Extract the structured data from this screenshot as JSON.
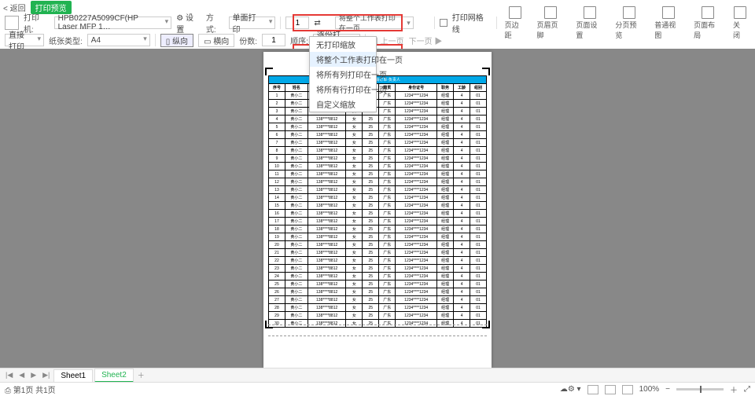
{
  "topbar": {
    "back": "< 返回",
    "title": "打印预览"
  },
  "toolbar": {
    "printer_label": "打印机:",
    "printer_name": "HPB0227A5099CF(HP Laser MFP 1…",
    "settings": "设置",
    "mode_label": "方式:",
    "mode_value": "单面打印",
    "copies_from": "1",
    "direct_print": "直接打印",
    "paper_label": "纸张类型:",
    "paper_value": "A4",
    "orient_portrait": "纵向",
    "orient_landscape": "横向",
    "copies_label": "份数:",
    "copies_value": "1",
    "order_label": "顺序:",
    "order_value": "逐份打印",
    "prev_page": "上一页",
    "next_page": "下一页",
    "scale_value": "将整个工作表打印在一页",
    "chk_gridlines": "打印网格线",
    "btns": {
      "margins": "页边距",
      "headerfooter": "页眉页脚",
      "pagesetup": "页面设置",
      "pagebreak": "分页预览",
      "normalview": "普通视图",
      "pagelayout": "页面布局",
      "close": "关闭"
    },
    "scale_menu": {
      "o1": "无打印缩放",
      "o2": "将整个工作表打印在一页",
      "o3": "将所有列打印在一页",
      "o4": "将所有行打印在一页",
      "o5": "自定义缩放"
    }
  },
  "table": {
    "title": "2022美妆类销订单·负责人",
    "headers": [
      "序号",
      "姓名",
      "联系方式",
      "性别",
      "年龄",
      "籍贯",
      "身份证号",
      "职务",
      "工龄",
      "组别"
    ],
    "row_name": "黄小二",
    "row_phone": "138****8812",
    "row_sex": "女",
    "row_age": "25",
    "row_jg": "广东",
    "row_id": "1234****1234",
    "row_job": "经理",
    "row_gl": "4",
    "row_zb": "01"
  },
  "sheets": {
    "s1": "Sheet1",
    "s2": "Sheet2"
  },
  "status": {
    "left": "第1页 共1页",
    "zoom": "100%"
  }
}
